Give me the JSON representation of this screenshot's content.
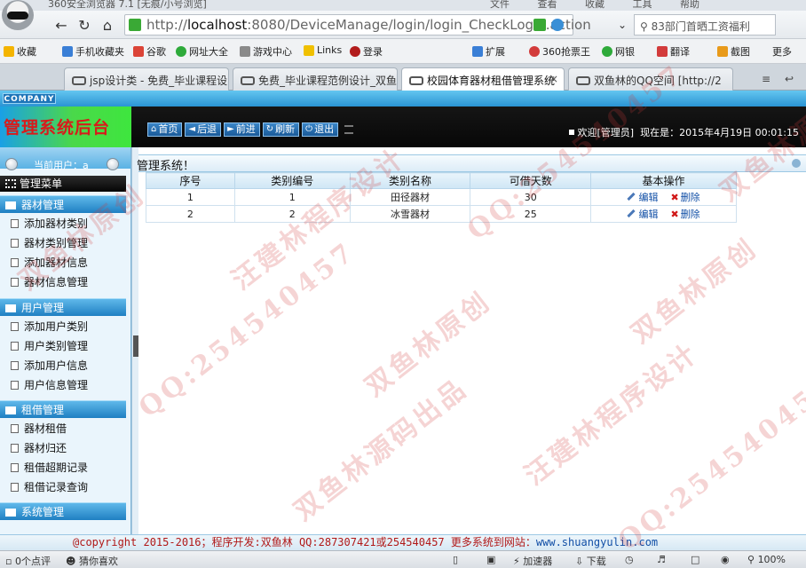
{
  "os": {
    "window_title": "360安全浏览器 7.1 [无痕/小号浏览]",
    "menu": "文件 查看 收藏 工具 帮助"
  },
  "browser": {
    "url_gray": "http://",
    "url_host": "localhost",
    "url_rest": ":8080/DeviceManage/login/login_CheckLogin.action",
    "search_text": "83部门首晒工资福利",
    "bookmarks": [
      "收藏",
      "手机收藏夹",
      "谷歌",
      "网址大全",
      "游戏中心",
      "Links",
      "登录",
      "扩展",
      "360抢票王",
      "网银",
      "翻译",
      "截图",
      "更多"
    ],
    "tabs": [
      {
        "label": "jsp设计类 - 免费_毕业课程设",
        "active": false
      },
      {
        "label": "免费_毕业课程范例设计_双鱼",
        "active": false
      },
      {
        "label": "校园体育器材租借管理系统",
        "active": true
      },
      {
        "label": "双鱼林的QQ空间 [http://2",
        "active": false
      }
    ],
    "tab_close": "×"
  },
  "header": {
    "company": "COMPANY",
    "system_title": "管理系统后台",
    "toolbar": [
      "首页",
      "后退",
      "前进",
      "刷新",
      "退出"
    ],
    "welcome": "欢迎[管理员]",
    "now_label": "现在是：",
    "datetime": "2015年4月19日 00:01:15"
  },
  "sidebar": {
    "current_user": "当前用户：a",
    "menu_title": "管理菜单",
    "groups": [
      {
        "title": "器材管理",
        "items": [
          "添加器材类别",
          "器材类别管理",
          "添加器材信息",
          "器材信息管理"
        ]
      },
      {
        "title": "用户管理",
        "items": [
          "添加用户类别",
          "用户类别管理",
          "添加用户信息",
          "用户信息管理"
        ]
      },
      {
        "title": "租借管理",
        "items": [
          "器材租借",
          "器材归还",
          "租借超期记录",
          "租借记录查询"
        ]
      },
      {
        "title": "系统管理",
        "items": []
      }
    ]
  },
  "main": {
    "breadcrumb": "管理系统！",
    "table": {
      "headers": [
        "序号",
        "类别编号",
        "类别名称",
        "可借天数",
        "基本操作"
      ],
      "rows": [
        {
          "seq": "1",
          "code": "1",
          "name": "田径器材",
          "days": "30"
        },
        {
          "seq": "2",
          "code": "2",
          "name": "冰雪器材",
          "days": "25"
        }
      ],
      "edit_label": "编辑",
      "delete_label": "删除"
    }
  },
  "footer": {
    "text": "@copyright 2015-2016；程序开发:双鱼林  QQ:287307421或254540457  更多系统到网站：",
    "site": "www.shuangyulin.com"
  },
  "statusbar": {
    "left": "0个点评",
    "guess": "猜你喜欢",
    "accelerator": "加速器",
    "download": "下载",
    "zoom": "100%"
  },
  "watermarks": [
    "双鱼林原创",
    "QQ:254540457",
    "汪建林程序设计",
    "双鱼林源码出品"
  ],
  "colors": {
    "accent_blue": "#1f7fc2",
    "logo_red": "#d81b1b",
    "header_black": "#070707",
    "footer_red": "#b01818",
    "link_blue": "#114fa6"
  }
}
